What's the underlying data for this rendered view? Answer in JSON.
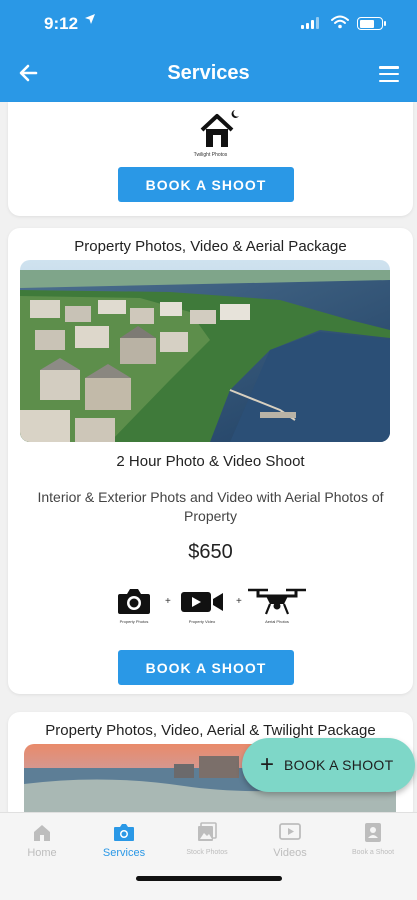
{
  "status_bar": {
    "time": "9:12"
  },
  "header": {
    "title": "Services"
  },
  "cards": [
    {
      "icon_caption": "Twilight Photos",
      "button": "BOOK A SHOOT"
    },
    {
      "title": "Property Photos, Video & Aerial Package",
      "subtitle": "2 Hour Photo & Video Shoot",
      "description": "Interior & Exterior Phots and Video with Aerial Photos of Property",
      "price": "$650",
      "icons": [
        {
          "name": "camera-icon",
          "caption": "Property Photos"
        },
        {
          "name": "video-icon",
          "caption": "Property Video"
        },
        {
          "name": "drone-icon",
          "caption": "Aerial Photos"
        }
      ],
      "button": "BOOK A SHOOT"
    },
    {
      "title": "Property Photos, Video, Aerial & Twilight Package"
    }
  ],
  "fab": {
    "label": "BOOK A SHOOT"
  },
  "tabbar": {
    "items": [
      {
        "label": "Home",
        "icon": "home-icon"
      },
      {
        "label": "Services",
        "icon": "camera-icon",
        "active": true
      },
      {
        "label": "Stock Photos",
        "icon": "photos-icon"
      },
      {
        "label": "Videos",
        "icon": "video-icon"
      },
      {
        "label": "Book a Shoot",
        "icon": "contact-icon"
      }
    ]
  },
  "colors": {
    "primary": "#2a98e6",
    "fab": "#7ed7c8"
  }
}
